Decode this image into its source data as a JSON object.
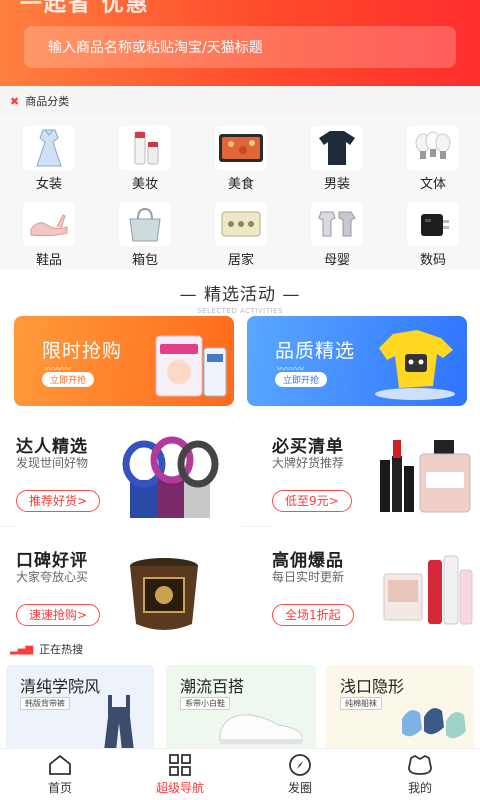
{
  "header": {
    "cut_title": "一起省 优惠",
    "search_placeholder": "输入商品名称或粘贴淘宝/天猫标题"
  },
  "category": {
    "title": "商品分类",
    "items": [
      {
        "label": "女装",
        "icon": "dress-icon"
      },
      {
        "label": "美妆",
        "icon": "cosmetics-icon"
      },
      {
        "label": "美食",
        "icon": "food-icon"
      },
      {
        "label": "男装",
        "icon": "tshirt-icon"
      },
      {
        "label": "文体",
        "icon": "bulbs-icon"
      },
      {
        "label": "鞋品",
        "icon": "shoe-icon"
      },
      {
        "label": "箱包",
        "icon": "bag-icon"
      },
      {
        "label": "居家",
        "icon": "home-icon"
      },
      {
        "label": "母婴",
        "icon": "baby-icon"
      },
      {
        "label": "数码",
        "icon": "charger-icon"
      }
    ]
  },
  "activities": {
    "title": "— 精选活动 —",
    "subtitle": "SELECTED ACTIVITIES",
    "promos": [
      {
        "title": "限时抢购",
        "button": "立即开抢",
        "color": "#ff7a22"
      },
      {
        "title": "品质精选",
        "button": "立即开抢",
        "color": "#3d86ff"
      }
    ]
  },
  "features": [
    {
      "title": "达人精选",
      "subtitle": "发现世间好物",
      "button": "推荐好货>"
    },
    {
      "title": "必买清单",
      "subtitle": "大牌好货推荐",
      "button": "低至9元>"
    },
    {
      "title": "口碑好评",
      "subtitle": "大家夸放心买",
      "button": "速速抢购>"
    },
    {
      "title": "高佣爆品",
      "subtitle": "每日实时更新",
      "button": "全场1折起"
    }
  ],
  "hot": {
    "title": "正在热搜",
    "items": [
      {
        "title": "清纯学院风",
        "tag": "韩版背带裤",
        "bg": "#eef3fb"
      },
      {
        "title": "潮流百搭",
        "tag": "系带小白鞋",
        "bg": "#eef8ef"
      },
      {
        "title": "浅口隐形",
        "tag": "纯棉船袜",
        "bg": "#fbf8ea"
      }
    ]
  },
  "nav": {
    "items": [
      {
        "label": "首页",
        "icon": "home-icon"
      },
      {
        "label": "超级导航",
        "icon": "grid-icon"
      },
      {
        "label": "发圈",
        "icon": "compass-icon"
      },
      {
        "label": "我的",
        "icon": "profile-icon"
      }
    ],
    "active_index": 1
  },
  "colors": {
    "accent": "#ff3b3b",
    "header_start": "#ff7f3f",
    "header_end": "#ff2e2e"
  }
}
